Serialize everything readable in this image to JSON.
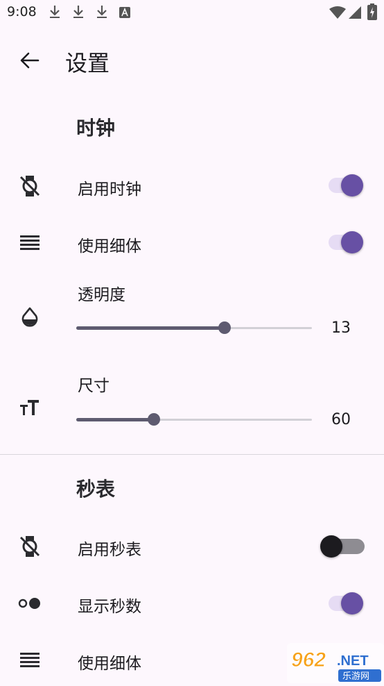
{
  "status_bar": {
    "time": "9:08",
    "notification_icons": [
      "download-icon",
      "download-icon",
      "download-icon",
      "font-icon"
    ],
    "system_icons": [
      "wifi-icon",
      "signal-icon",
      "battery-charging-icon"
    ]
  },
  "app_bar": {
    "title": "设置",
    "back_icon": "arrow-back-icon"
  },
  "clock_section": {
    "title": "时钟",
    "enable": {
      "label": "启用时钟",
      "on": true,
      "icon": "watch-off-icon"
    },
    "thin": {
      "label": "使用细体",
      "on": true,
      "icon": "lines-icon"
    },
    "opacity": {
      "label": "透明度",
      "value": "13",
      "fraction": 0.63,
      "icon": "opacity-icon"
    },
    "size": {
      "label": "尺寸",
      "value": "60",
      "fraction": 0.33,
      "icon": "text-size-icon"
    }
  },
  "stopwatch_section": {
    "title": "秒表",
    "enable": {
      "label": "启用秒表",
      "on": false,
      "icon": "watch-off-icon"
    },
    "show_seconds": {
      "label": "显示秒数",
      "on": true,
      "icon": "dots-icon"
    },
    "thin": {
      "label": "使用细体",
      "icon": "lines-icon"
    }
  },
  "watermark": {
    "text": "962.NET",
    "subtext": "乐游网"
  },
  "colors": {
    "accent": "#6750a4",
    "background": "#fdf7fd"
  }
}
